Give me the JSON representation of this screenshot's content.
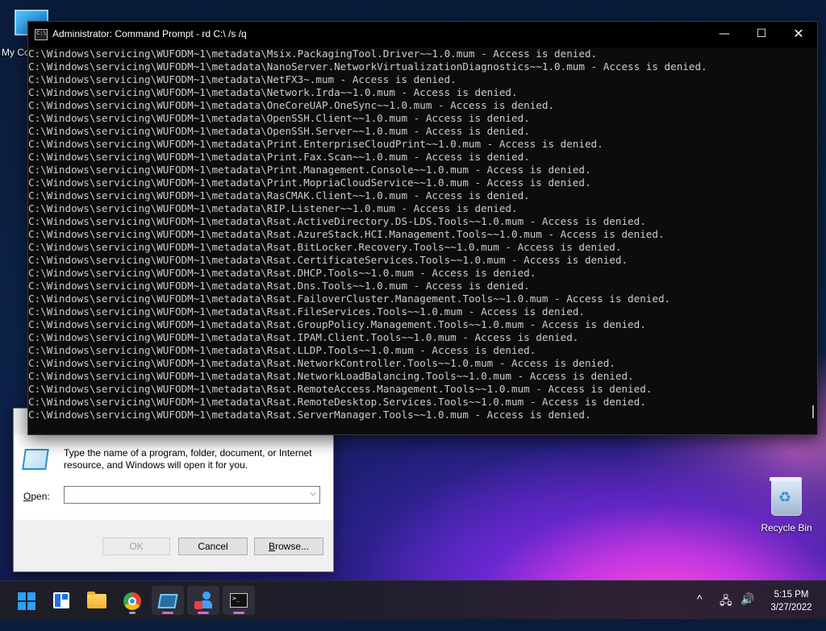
{
  "desktop": {
    "mypc_label": "My Co",
    "recycle_bin_label": "Recycle Bin"
  },
  "cmd_window": {
    "title": "Administrator: Command Prompt - rd  C:\\ /s /q",
    "minimize": "—",
    "maximize": "☐",
    "close": "✕",
    "lines": [
      "C:\\Windows\\servicing\\WUFODM~1\\metadata\\Msix.PackagingTool.Driver~~1.0.mum - Access is denied.",
      "C:\\Windows\\servicing\\WUFODM~1\\metadata\\NanoServer.NetworkVirtualizationDiagnostics~~1.0.mum - Access is denied.",
      "C:\\Windows\\servicing\\WUFODM~1\\metadata\\NetFX3~.mum - Access is denied.",
      "C:\\Windows\\servicing\\WUFODM~1\\metadata\\Network.Irda~~1.0.mum - Access is denied.",
      "C:\\Windows\\servicing\\WUFODM~1\\metadata\\OneCoreUAP.OneSync~~1.0.mum - Access is denied.",
      "C:\\Windows\\servicing\\WUFODM~1\\metadata\\OpenSSH.Client~~1.0.mum - Access is denied.",
      "C:\\Windows\\servicing\\WUFODM~1\\metadata\\OpenSSH.Server~~1.0.mum - Access is denied.",
      "C:\\Windows\\servicing\\WUFODM~1\\metadata\\Print.EnterpriseCloudPrint~~1.0.mum - Access is denied.",
      "C:\\Windows\\servicing\\WUFODM~1\\metadata\\Print.Fax.Scan~~1.0.mum - Access is denied.",
      "C:\\Windows\\servicing\\WUFODM~1\\metadata\\Print.Management.Console~~1.0.mum - Access is denied.",
      "C:\\Windows\\servicing\\WUFODM~1\\metadata\\Print.MopriaCloudService~~1.0.mum - Access is denied.",
      "C:\\Windows\\servicing\\WUFODM~1\\metadata\\RasCMAK.Client~~1.0.mum - Access is denied.",
      "C:\\Windows\\servicing\\WUFODM~1\\metadata\\RIP.Listener~~1.0.mum - Access is denied.",
      "C:\\Windows\\servicing\\WUFODM~1\\metadata\\Rsat.ActiveDirectory.DS-LDS.Tools~~1.0.mum - Access is denied.",
      "C:\\Windows\\servicing\\WUFODM~1\\metadata\\Rsat.AzureStack.HCI.Management.Tools~~1.0.mum - Access is denied.",
      "C:\\Windows\\servicing\\WUFODM~1\\metadata\\Rsat.BitLocker.Recovery.Tools~~1.0.mum - Access is denied.",
      "C:\\Windows\\servicing\\WUFODM~1\\metadata\\Rsat.CertificateServices.Tools~~1.0.mum - Access is denied.",
      "C:\\Windows\\servicing\\WUFODM~1\\metadata\\Rsat.DHCP.Tools~~1.0.mum - Access is denied.",
      "C:\\Windows\\servicing\\WUFODM~1\\metadata\\Rsat.Dns.Tools~~1.0.mum - Access is denied.",
      "C:\\Windows\\servicing\\WUFODM~1\\metadata\\Rsat.FailoverCluster.Management.Tools~~1.0.mum - Access is denied.",
      "C:\\Windows\\servicing\\WUFODM~1\\metadata\\Rsat.FileServices.Tools~~1.0.mum - Access is denied.",
      "C:\\Windows\\servicing\\WUFODM~1\\metadata\\Rsat.GroupPolicy.Management.Tools~~1.0.mum - Access is denied.",
      "C:\\Windows\\servicing\\WUFODM~1\\metadata\\Rsat.IPAM.Client.Tools~~1.0.mum - Access is denied.",
      "C:\\Windows\\servicing\\WUFODM~1\\metadata\\Rsat.LLDP.Tools~~1.0.mum - Access is denied.",
      "C:\\Windows\\servicing\\WUFODM~1\\metadata\\Rsat.NetworkController.Tools~~1.0.mum - Access is denied.",
      "C:\\Windows\\servicing\\WUFODM~1\\metadata\\Rsat.NetworkLoadBalancing.Tools~~1.0.mum - Access is denied.",
      "C:\\Windows\\servicing\\WUFODM~1\\metadata\\Rsat.RemoteAccess.Management.Tools~~1.0.mum - Access is denied.",
      "C:\\Windows\\servicing\\WUFODM~1\\metadata\\Rsat.RemoteDesktop.Services.Tools~~1.0.mum - Access is denied.",
      "C:\\Windows\\servicing\\WUFODM~1\\metadata\\Rsat.ServerManager.Tools~~1.0.mum - Access is denied."
    ]
  },
  "run_dialog": {
    "description": "Type the name of a program, folder, document, or Internet resource, and Windows will open it for you.",
    "open_label_accel": "O",
    "open_label_rest": "pen:",
    "open_value": "",
    "ok_label": "OK",
    "cancel_label": "Cancel",
    "browse_label_accel": "B",
    "browse_label_rest": "rowse..."
  },
  "taskbar": {
    "apps": [
      "start",
      "widgets",
      "file-explorer",
      "chrome",
      "run",
      "users",
      "command-prompt"
    ],
    "tray_chevron": "^",
    "time": "5:15 PM",
    "date": "3/27/2022"
  },
  "colors": {
    "terminal_bg": "#0c0c0c",
    "terminal_fg": "#cccccc",
    "accent": "#2aa0ff"
  }
}
